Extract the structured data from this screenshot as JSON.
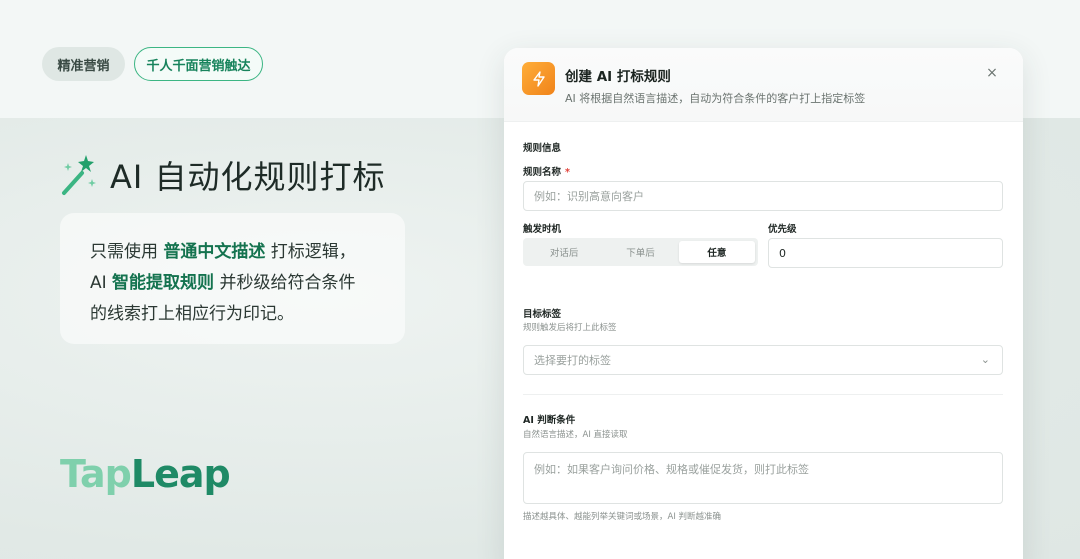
{
  "tags": {
    "left": "精准营销",
    "right": "千人千面营销触达"
  },
  "hero": {
    "title": "AI 自动化规则打标",
    "line1_pre": "只需使用 ",
    "line1_hl": "普通中文描述",
    "line1_post": " 打标逻辑，",
    "line2_pre": "AI  ",
    "line2_hl": "智能提取规则",
    "line2_post": " 并秒级给符合条件",
    "line3": "的线索打上相应行为印记。"
  },
  "logo": {
    "part1": "Tap",
    "part2": "Leap"
  },
  "modal": {
    "title": "创建 AI 打标规则",
    "subtitle": "AI 将根据自然语言描述，自动为符合条件的客户打上指定标签",
    "close": "×",
    "section_info": "规则信息",
    "rule_name_label": "规则名称",
    "rule_name_required": "*",
    "rule_name_placeholder": "例如：识别高意向客户",
    "trigger_label": "触发时机",
    "trigger_options": [
      "对话后",
      "下单后",
      "任意"
    ],
    "trigger_selected": "任意",
    "priority_label": "优先级",
    "priority_value": "0",
    "target_label": "目标标签",
    "target_hint": "规则触发后将打上此标签",
    "target_placeholder": "选择要打的标签",
    "ai_label": "AI 判断条件",
    "ai_hint": "自然语言描述，AI 直接读取",
    "ai_placeholder": "例如：如果客户询问价格、规格或催促发货，则打此标签",
    "ai_footer": "描述越具体、越能列举关键词或场景，AI 判断越准确"
  },
  "colors": {
    "accent": "#17835c",
    "orange": "#f0831a"
  }
}
